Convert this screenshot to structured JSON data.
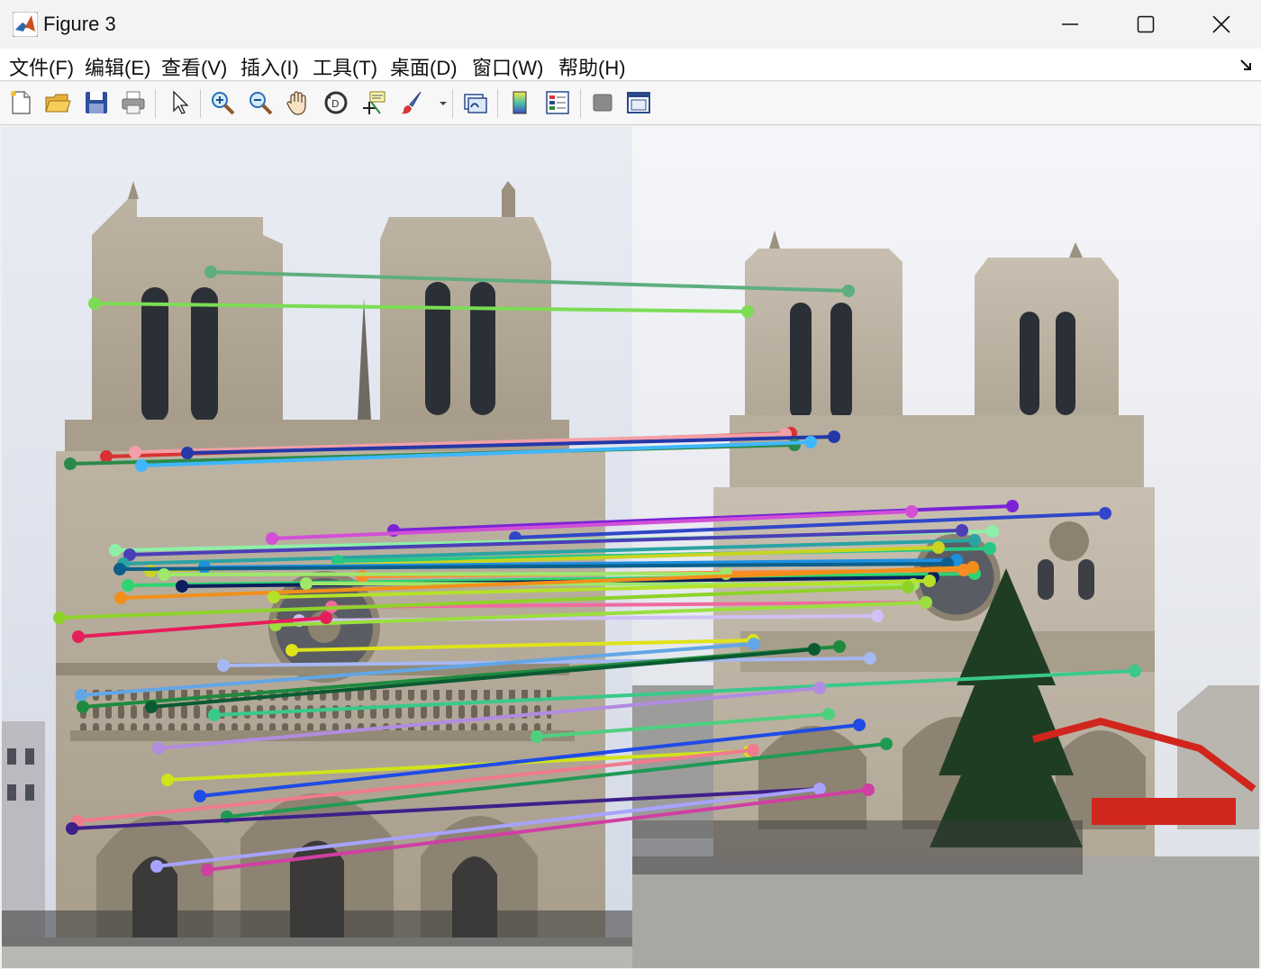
{
  "window": {
    "title": "Figure 3",
    "icon": "matlab-logo-icon",
    "controls": {
      "minimize": "minimize-icon",
      "maximize": "maximize-icon",
      "close": "close-icon"
    }
  },
  "menu": {
    "items": [
      {
        "id": "file",
        "label": "文件(F)"
      },
      {
        "id": "edit",
        "label": "编辑(E)"
      },
      {
        "id": "view",
        "label": "查看(V)"
      },
      {
        "id": "insert",
        "label": "插入(I)"
      },
      {
        "id": "tools",
        "label": "工具(T)"
      },
      {
        "id": "desktop",
        "label": "桌面(D)"
      },
      {
        "id": "window",
        "label": "窗口(W)"
      },
      {
        "id": "help",
        "label": "帮助(H)"
      }
    ],
    "dock_icon": "dock-arrow-icon"
  },
  "toolbar": {
    "buttons": [
      {
        "id": "new",
        "icon": "new-figure-icon"
      },
      {
        "id": "open",
        "icon": "open-file-icon"
      },
      {
        "id": "save",
        "icon": "save-icon"
      },
      {
        "id": "print",
        "icon": "print-icon"
      },
      {
        "id": "edit-plot",
        "icon": "pointer-icon"
      },
      {
        "id": "zoom-in",
        "icon": "zoom-in-icon"
      },
      {
        "id": "zoom-out",
        "icon": "zoom-out-icon"
      },
      {
        "id": "pan",
        "icon": "pan-hand-icon"
      },
      {
        "id": "rotate",
        "icon": "rotate-3d-icon"
      },
      {
        "id": "data-cursor",
        "icon": "data-cursor-icon"
      },
      {
        "id": "brush",
        "icon": "brush-icon"
      },
      {
        "id": "link",
        "icon": "link-plot-icon"
      },
      {
        "id": "colorbar",
        "icon": "colorbar-icon"
      },
      {
        "id": "legend",
        "icon": "legend-icon"
      },
      {
        "id": "hide-tools",
        "icon": "hide-plot-tools-icon"
      },
      {
        "id": "show-tools",
        "icon": "show-plot-tools-icon"
      }
    ]
  },
  "figure": {
    "content": "feature-matching-visualization",
    "left_image": "notre-dame-left-photo",
    "right_image": "notre-dame-right-photo",
    "sky_color": "#dfe3ec",
    "stone_color": "#b3a896"
  }
}
